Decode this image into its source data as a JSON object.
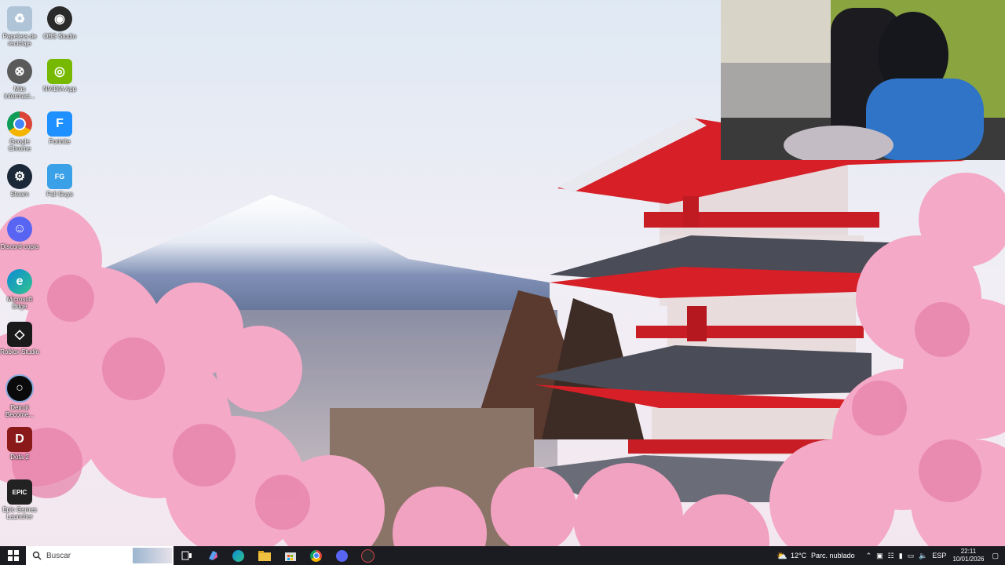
{
  "desktop": {
    "icons": [
      {
        "label": "Papelera de reciclaje",
        "icon": "recycle-bin-icon",
        "color": "#b0c4d8"
      },
      {
        "label": "OBS Studio",
        "icon": "obs-icon",
        "color": "#2a2a2a"
      },
      {
        "label": "Más informaci...",
        "icon": "info-icon",
        "color": "#5a5a5a"
      },
      {
        "label": "NVIDIA App",
        "icon": "nvidia-icon",
        "color": "#76b900"
      },
      {
        "label": "Google Chrome",
        "icon": "chrome-icon",
        "color": "#db4437"
      },
      {
        "label": "Fortnite",
        "icon": "fortnite-icon",
        "color": "#1e90ff"
      },
      {
        "label": "Steam",
        "icon": "steam-icon",
        "color": "#1b2838"
      },
      {
        "label": "Fall Guys",
        "icon": "fall-guys-icon",
        "color": "#3aa0e8"
      },
      {
        "label": "Discord copia",
        "icon": "discord-icon",
        "color": "#5865f2"
      },
      {
        "label": "Microsoft Edge",
        "icon": "edge-icon",
        "color": "#0c8bd6"
      },
      {
        "label": "Roblox Studio",
        "icon": "roblox-icon",
        "color": "#1a1a1a"
      },
      {
        "label": "Detroit Become...",
        "icon": "detroit-icon",
        "color": "#0a0a0a"
      },
      {
        "label": "Dota 2",
        "icon": "dota-icon",
        "color": "#8a1a1a"
      },
      {
        "label": "Epic Games Launcher",
        "icon": "epic-icon",
        "color": "#222222"
      }
    ]
  },
  "taskbar": {
    "search_placeholder": "Buscar",
    "apps": [
      "task-view-icon",
      "copilot-icon",
      "edge-icon",
      "file-explorer-icon",
      "store-icon",
      "chrome-icon",
      "discord-icon",
      "obs-icon"
    ],
    "weather_temp": "12°C",
    "weather_text": "Parc. nublado",
    "language": "ESP",
    "time": "22:11",
    "date": "10/01/2026"
  }
}
